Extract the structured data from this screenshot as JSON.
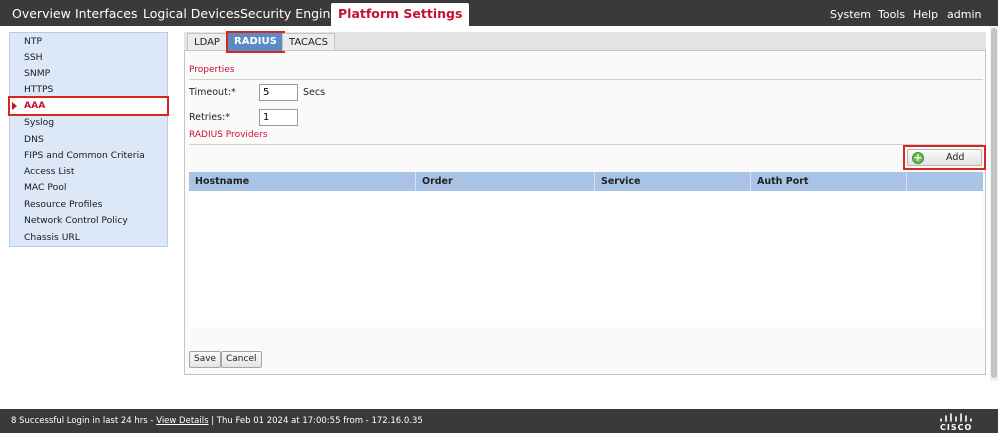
{
  "topnav": {
    "tabs": [
      "Overview",
      "Interfaces",
      "Logical Devices",
      "Security Engine",
      "Platform Settings"
    ],
    "active_tab": "Platform Settings",
    "right_menu": [
      "System",
      "Tools",
      "Help",
      "admin"
    ]
  },
  "sidebar": {
    "items": [
      "NTP",
      "SSH",
      "SNMP",
      "HTTPS",
      "AAA",
      "Syslog",
      "DNS",
      "FIPS and Common Criteria",
      "Access List",
      "MAC Pool",
      "Resource Profiles",
      "Network Control Policy",
      "Chassis URL"
    ],
    "active_item": "AAA"
  },
  "subtabs": {
    "items": [
      "LDAP",
      "RADIUS",
      "TACACS"
    ],
    "active": "RADIUS"
  },
  "properties": {
    "title": "Properties",
    "timeout_label": "Timeout:*",
    "timeout_value": "5",
    "timeout_unit": "Secs",
    "retries_label": "Retries:*",
    "retries_value": "1"
  },
  "providers": {
    "title": "RADIUS Providers",
    "add_label": "Add",
    "columns": [
      "Hostname",
      "Order",
      "Service",
      "Auth Port"
    ],
    "rows": []
  },
  "footer_buttons": {
    "save": "Save",
    "cancel": "Cancel"
  },
  "statusbar": {
    "prefix": "8 Successful Login in last 24 hrs - ",
    "link": "View Details",
    "suffix": " | Thu Feb 01 2024 at 17:00:55 from - 172.16.0.35",
    "brand": "CISCO"
  },
  "colors": {
    "accent_red": "#c8102e",
    "nav_bg": "#3a3a3a",
    "active_subtab": "#5b8ac6",
    "table_header": "#a9c3e6",
    "sidebar_bg": "#dce8f7",
    "highlight_outline": "#d6281e"
  }
}
